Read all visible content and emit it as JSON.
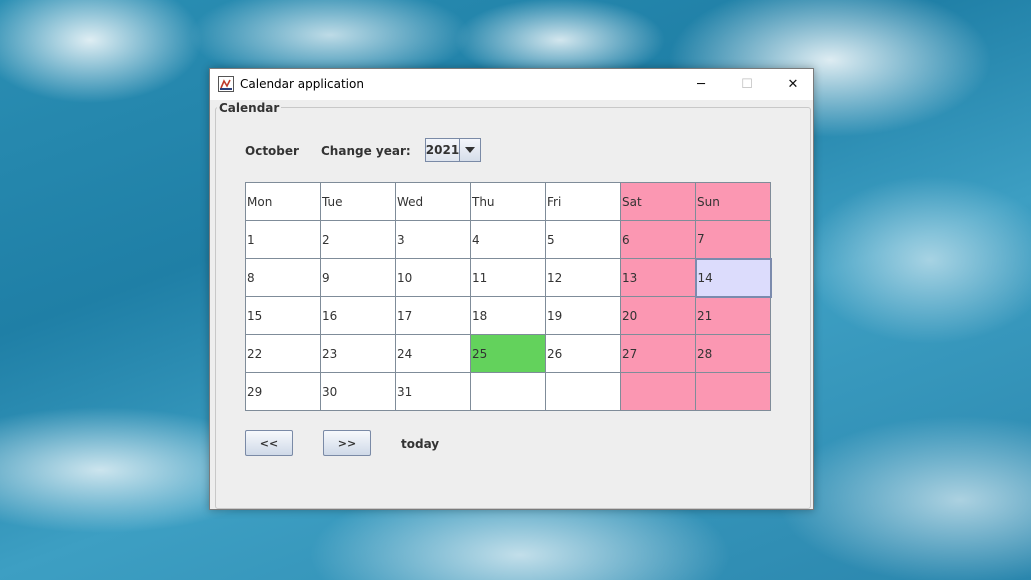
{
  "window": {
    "title": "Calendar application",
    "minimize": "─",
    "maximize": "☐",
    "close": "✕",
    "icon": "java-app-icon"
  },
  "panel": {
    "label": "Calendar"
  },
  "header": {
    "month": "October",
    "change_year_label": "Change year:",
    "year": "2021",
    "year_dropdown_icon": "triangle-down-icon"
  },
  "calendar": {
    "weekdays": [
      "Mon",
      "Tue",
      "Wed",
      "Thu",
      "Fri",
      "Sat",
      "Sun"
    ],
    "weeks": [
      [
        "1",
        "2",
        "3",
        "4",
        "5",
        "6",
        "7"
      ],
      [
        "8",
        "9",
        "10",
        "11",
        "12",
        "13",
        "14"
      ],
      [
        "15",
        "16",
        "17",
        "18",
        "19",
        "20",
        "21"
      ],
      [
        "22",
        "23",
        "24",
        "25",
        "26",
        "27",
        "28"
      ],
      [
        "29",
        "30",
        "31",
        "",
        "",
        "",
        ""
      ]
    ],
    "today_day": "25",
    "selected_day": "14",
    "colors": {
      "weekend": "#fb97b2",
      "today": "#63d25c",
      "selected": "#dcdcfc"
    }
  },
  "navigation": {
    "prev_label": "<<",
    "next_label": ">>",
    "today_label": "today"
  }
}
